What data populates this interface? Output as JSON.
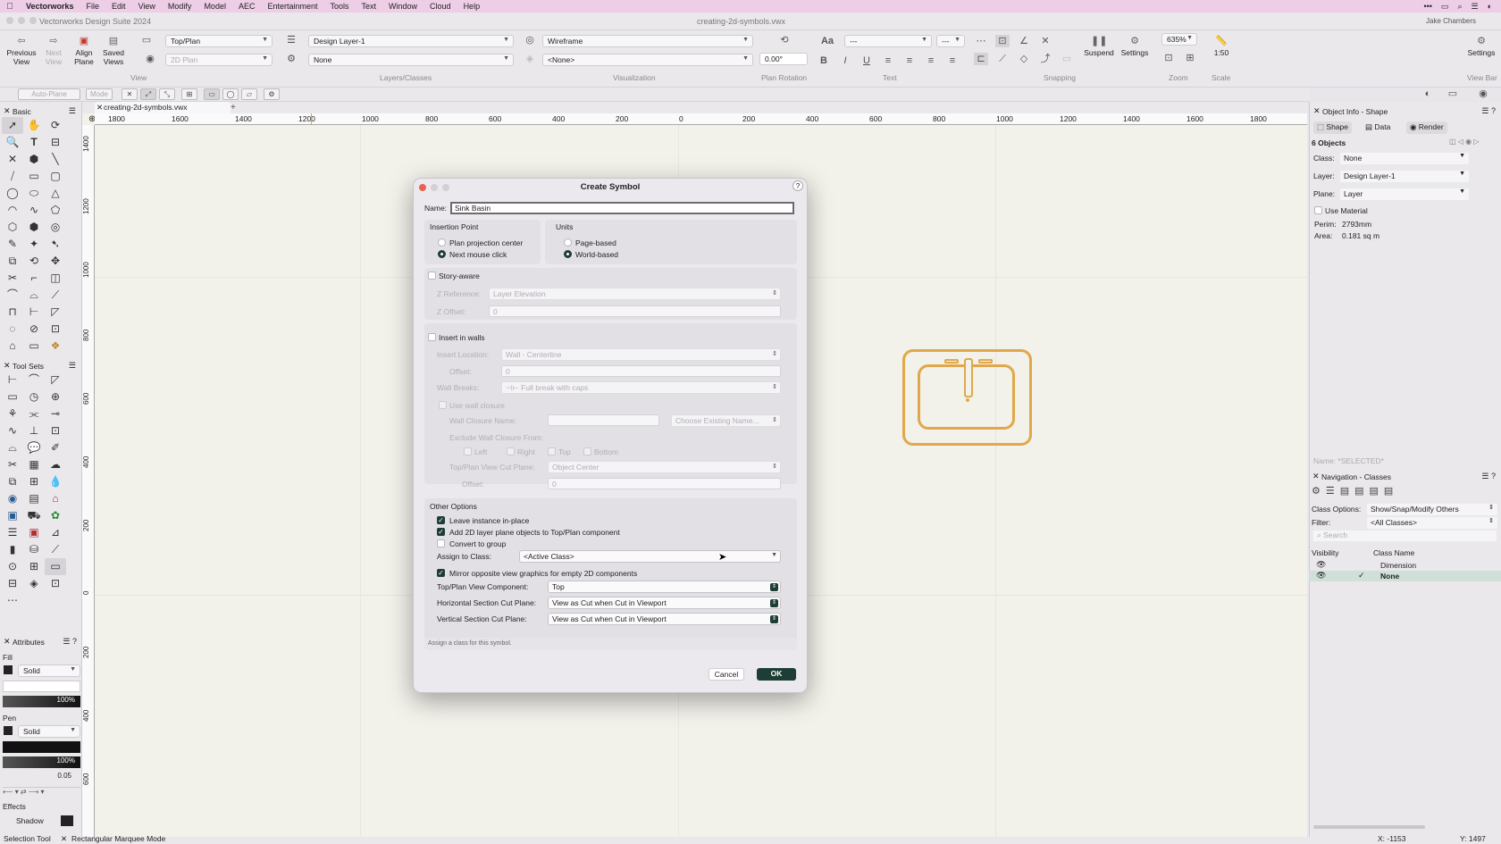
{
  "menubar": {
    "app": "Vectorworks",
    "items": [
      "File",
      "Edit",
      "View",
      "Modify",
      "Model",
      "AEC",
      "Entertainment",
      "Tools",
      "Text",
      "Window",
      "Cloud",
      "Help"
    ]
  },
  "window": {
    "app_title": "Vectorworks Design Suite 2024",
    "doc_title": "creating-2d-symbols.vwx",
    "user": "Jake Chambers"
  },
  "toolbar": {
    "previous_view": "Previous View",
    "next_view": "Next View",
    "align_plane": "Align Plane",
    "saved_views": "Saved Views",
    "view_select": "Top/Plan",
    "plane_select": "2D Plan",
    "layer_select": "Design Layer-1",
    "class_select": "None",
    "render_select": "Wireframe",
    "vis_select": "<None>",
    "plan_rotation": "0.00°",
    "font_select": "---",
    "size_select": "---",
    "suspend": "Suspend",
    "settings": "Settings",
    "zoom": "635%",
    "scale": "1:50",
    "settings_right": "Settings",
    "view_bar": "View Bar",
    "group_view": "View",
    "group_layers": "Layers/Classes",
    "group_vis": "Visualization",
    "group_rotation": "Plan Rotation",
    "group_text": "Text",
    "group_snapping": "Snapping",
    "group_zoom": "Zoom",
    "group_scale": "Scale"
  },
  "modebar": {
    "auto_plane": "Auto-Plane",
    "mode": "Mode"
  },
  "palettes": {
    "basic": "Basic",
    "tool_sets": "Tool Sets",
    "attributes": "Attributes",
    "fill": "Fill",
    "fill_style": "Solid",
    "fill_opacity": "100%",
    "pen": "Pen",
    "pen_style": "Solid",
    "pen_opacity": "100%",
    "pen_weight": "0.05",
    "effects": "Effects",
    "shadow": "Shadow"
  },
  "document_tab": "creating-2d-symbols.vwx",
  "rulers": {
    "h": [
      "1800",
      "1600",
      "1400",
      "1200",
      "1000",
      "800",
      "600",
      "400",
      "200",
      "0",
      "200",
      "400",
      "600",
      "800",
      "1000",
      "1200",
      "1400",
      "1600",
      "1800"
    ],
    "v": [
      "1400",
      "1200",
      "1000",
      "800",
      "600",
      "400",
      "200",
      "0",
      "200",
      "400",
      "600"
    ]
  },
  "dialog": {
    "title": "Create Symbol",
    "name_label": "Name:",
    "name_value": "Sink Basin",
    "insertion_point": "Insertion Point",
    "plan_projection_center": "Plan projection center",
    "next_mouse_click": "Next mouse click",
    "units": "Units",
    "page_based": "Page-based",
    "world_based": "World-based",
    "story_aware": "Story-aware",
    "z_reference_label": "Z Reference:",
    "z_reference_value": "Layer Elevation",
    "z_offset_label": "Z Offset:",
    "z_offset_value": "0",
    "insert_in_walls": "Insert in walls",
    "insert_location_label": "Insert Location:",
    "insert_location_value": "Wall - Centerline",
    "offset_label": "Offset:",
    "offset_value": "0",
    "wall_breaks_label": "Wall Breaks:",
    "wall_breaks_value": "Full break with caps",
    "use_wall_closure": "Use wall closure",
    "wall_closure_name_label": "Wall Closure Name:",
    "choose_existing": "Choose Existing Name...",
    "exclude_label": "Exclude Wall Closure From:",
    "left": "Left",
    "right": "Right",
    "top": "Top",
    "bottom": "Bottom",
    "cut_plane_label": "Top/Plan View Cut Plane:",
    "cut_plane_value": "Object Center",
    "offset2_label": "Offset:",
    "offset2_value": "0",
    "other_options": "Other Options",
    "leave_instance": "Leave instance in-place",
    "add_2d": "Add 2D layer plane objects to Top/Plan component",
    "convert_group": "Convert to group",
    "assign_class_label": "Assign to Class:",
    "assign_class_value": "<Active Class>",
    "mirror": "Mirror opposite view graphics for empty 2D components",
    "top_plan_comp_label": "Top/Plan View Component:",
    "top_plan_comp_value": "Top",
    "hsection_label": "Horizontal Section Cut Plane:",
    "hsection_value": "View as Cut when Cut in Viewport",
    "vsection_label": "Vertical Section Cut Plane:",
    "vsection_value": "View as Cut when Cut in Viewport",
    "help_text": "Assign a class for this symbol.",
    "cancel": "Cancel",
    "ok": "OK"
  },
  "object_info": {
    "title": "Object Info - Shape",
    "tab_shape": "Shape",
    "tab_data": "Data",
    "tab_render": "Render",
    "count": "6 Objects",
    "class_label": "Class:",
    "class_value": "None",
    "layer_label": "Layer:",
    "layer_value": "Design Layer-1",
    "plane_label": "Plane:",
    "plane_value": "Layer",
    "use_material": "Use Material",
    "perim_label": "Perim:",
    "perim_value": "2793mm",
    "area_label": "Area:",
    "area_value": "0.181 sq m",
    "name_label": "Name: *SELECTED*"
  },
  "navigation": {
    "title": "Navigation - Classes",
    "class_options_label": "Class Options:",
    "class_options_value": "Show/Snap/Modify Others",
    "filter_label": "Filter:",
    "filter_value": "<All Classes>",
    "search_placeholder": "Search",
    "col_visibility": "Visibility",
    "col_class_name": "Class Name",
    "rows": [
      {
        "name": "Dimension"
      },
      {
        "name": "None"
      }
    ]
  },
  "status": {
    "tool": "Selection Tool",
    "mode": "Rectangular Marquee Mode",
    "x": "X: -1153",
    "y": "Y: 1497"
  },
  "colors": {
    "accent": "#1e3d34",
    "menubar": "#eecde6",
    "symbol": "#e0a84a"
  }
}
